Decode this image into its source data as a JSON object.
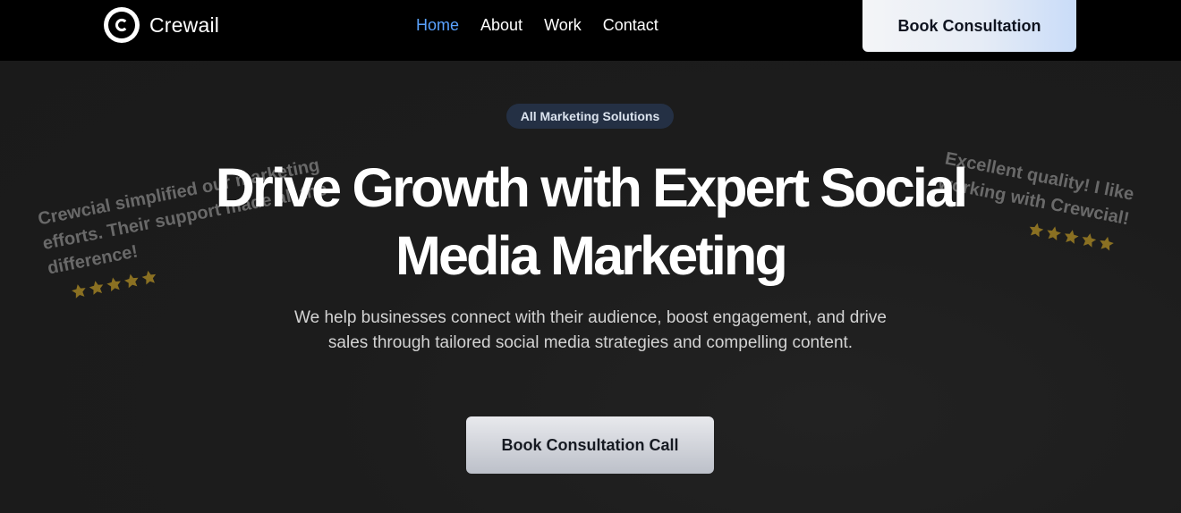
{
  "brand": {
    "name": "Crewail"
  },
  "nav": {
    "links": [
      {
        "label": "Home",
        "active": true
      },
      {
        "label": "About",
        "active": false
      },
      {
        "label": "Work",
        "active": false
      },
      {
        "label": "Contact",
        "active": false
      }
    ],
    "cta_label": "Book Consultation"
  },
  "hero": {
    "badge": "All Marketing Solutions",
    "headline_line1": "Drive Growth with Expert Social",
    "headline_line2": "Media Marketing",
    "subtext": "We help businesses connect with their audience, boost engagement, and drive sales through tailored social media strategies and compelling content.",
    "cta_label": "Book Consultation Call"
  },
  "testimonials": [
    {
      "text": "Crewcial simplified our marketing efforts. Their support made all the difference!",
      "rating": 5
    },
    {
      "text": "Excellent quality! I like working with Crewcial!",
      "rating": 5
    }
  ],
  "colors": {
    "nav_active": "#5aa2ff",
    "badge_bg": "#243044",
    "star": "#8a7022"
  },
  "icons": {
    "logo": "c-circle-logo-icon",
    "star": "star-icon"
  }
}
